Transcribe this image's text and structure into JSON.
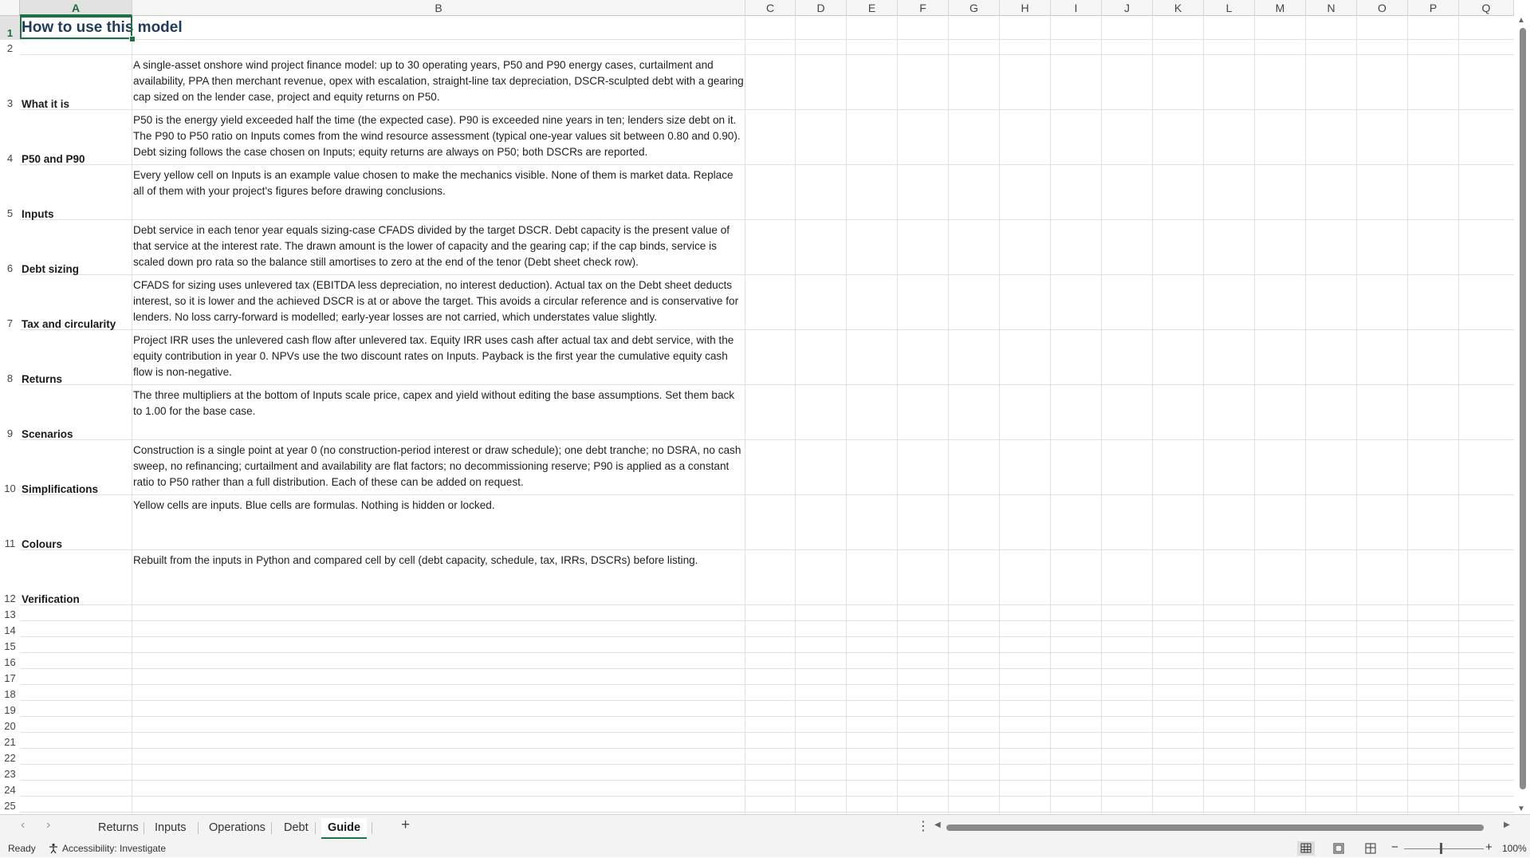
{
  "columns": [
    "A",
    "B",
    "C",
    "D",
    "E",
    "F",
    "G",
    "H",
    "I",
    "J",
    "K",
    "L",
    "M",
    "N",
    "O",
    "P",
    "Q"
  ],
  "row_numbers": [
    "1",
    "2",
    "3",
    "4",
    "5",
    "6",
    "7",
    "8",
    "9",
    "10",
    "11",
    "12",
    "13",
    "14",
    "15",
    "16",
    "17",
    "18",
    "19",
    "20",
    "21",
    "22",
    "23",
    "24",
    "25"
  ],
  "sheet": {
    "title_part1": "How to use this",
    "title_part2": " model",
    "rows": [
      {
        "label": "What it is",
        "text": "A single-asset onshore wind project finance model: up to 30 operating years, P50 and P90 energy cases, curtailment and availability, PPA then merchant revenue, opex with escalation, straight-line tax depreciation, DSCR-sculpted debt with a gearing cap sized on the lender case, project and equity returns on P50."
      },
      {
        "label": "P50 and P90",
        "text": "P50 is the energy yield exceeded half the time (the expected case). P90 is exceeded nine years in ten; lenders size debt on it. The P90 to P50 ratio on Inputs comes from the wind resource assessment (typical one-year values sit between 0.80 and 0.90). Debt sizing follows the case chosen on Inputs; equity returns are always on P50; both DSCRs are reported."
      },
      {
        "label": "Inputs",
        "text": "Every yellow cell on Inputs is an example value chosen to make the mechanics visible. None of them is market data. Replace all of them with your project's figures before drawing conclusions."
      },
      {
        "label": "Debt sizing",
        "text": "Debt service in each tenor year equals sizing-case CFADS divided by the target DSCR. Debt capacity is the present value of that service at the interest rate. The drawn amount is the lower of capacity and the gearing cap; if the cap binds, service is scaled down pro rata so the balance still amortises to zero at the end of the tenor (Debt sheet check row)."
      },
      {
        "label": "Tax and circularity",
        "text": "CFADS for sizing uses unlevered tax (EBITDA less depreciation, no interest deduction). Actual tax on the Debt sheet deducts interest, so it is lower and the achieved DSCR is at or above the target. This avoids a circular reference and is conservative for lenders. No loss carry-forward is modelled; early-year losses are not carried, which understates value slightly."
      },
      {
        "label": "Returns",
        "text": "Project IRR uses the unlevered cash flow after unlevered tax. Equity IRR uses cash after actual tax and debt service, with the equity contribution in year 0. NPVs use the two discount rates on Inputs. Payback is the first year the cumulative equity cash flow is non-negative."
      },
      {
        "label": "Scenarios",
        "text": "The three multipliers at the bottom of Inputs scale price, capex and yield without editing the base assumptions. Set them back to 1.00 for the base case."
      },
      {
        "label": "Simplifications",
        "text": "Construction is a single point at year 0 (no construction-period interest or draw schedule); one debt tranche; no DSRA, no cash sweep, no refinancing; curtailment and availability are flat factors; no decommissioning reserve; P90 is applied as a constant ratio to P50 rather than a full distribution. Each of these can be added on request."
      },
      {
        "label": "Colours",
        "text": "Yellow cells are inputs. Blue cells are formulas. Nothing is hidden or locked."
      },
      {
        "label": "Verification",
        "text": "Rebuilt from the inputs in Python and compared cell by cell (debt capacity, schedule, tax, IRRs, DSCRs) before listing."
      }
    ]
  },
  "tabs": [
    {
      "label": "Returns",
      "active": false
    },
    {
      "label": "Inputs",
      "active": false
    },
    {
      "label": "Operations",
      "active": false
    },
    {
      "label": "Debt",
      "active": false
    },
    {
      "label": "Guide",
      "active": true
    }
  ],
  "status": {
    "ready": "Ready",
    "accessibility": "Accessibility: Investigate",
    "zoom": "100%",
    "zoom_out": "−",
    "zoom_in": "+"
  },
  "icons": {
    "add_sheet": "+",
    "tab_menu": "⋮",
    "prev": "‹",
    "next": "›"
  },
  "colors": {
    "accent": "#1e7145",
    "title": "#1f3a5a"
  }
}
